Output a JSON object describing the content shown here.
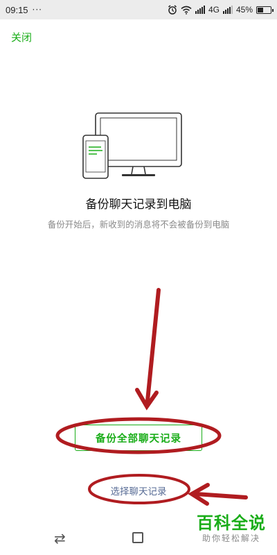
{
  "status_bar": {
    "time": "09:15",
    "dots": "···",
    "network": "4G",
    "battery": "45%",
    "battery_level": 0.45
  },
  "header": {
    "close_label": "关闭"
  },
  "main": {
    "title": "备份聊天记录到电脑",
    "subtitle": "备份开始后，新收到的消息将不会被备份到电脑"
  },
  "actions": {
    "backup_all_label": "备份全部聊天记录",
    "select_label": "选择聊天记录"
  },
  "watermark": {
    "main": "百科全说",
    "sub": "助你轻松解决"
  },
  "colors": {
    "accent": "#1aad19",
    "link": "#576b95",
    "annotation": "#b01c20"
  }
}
